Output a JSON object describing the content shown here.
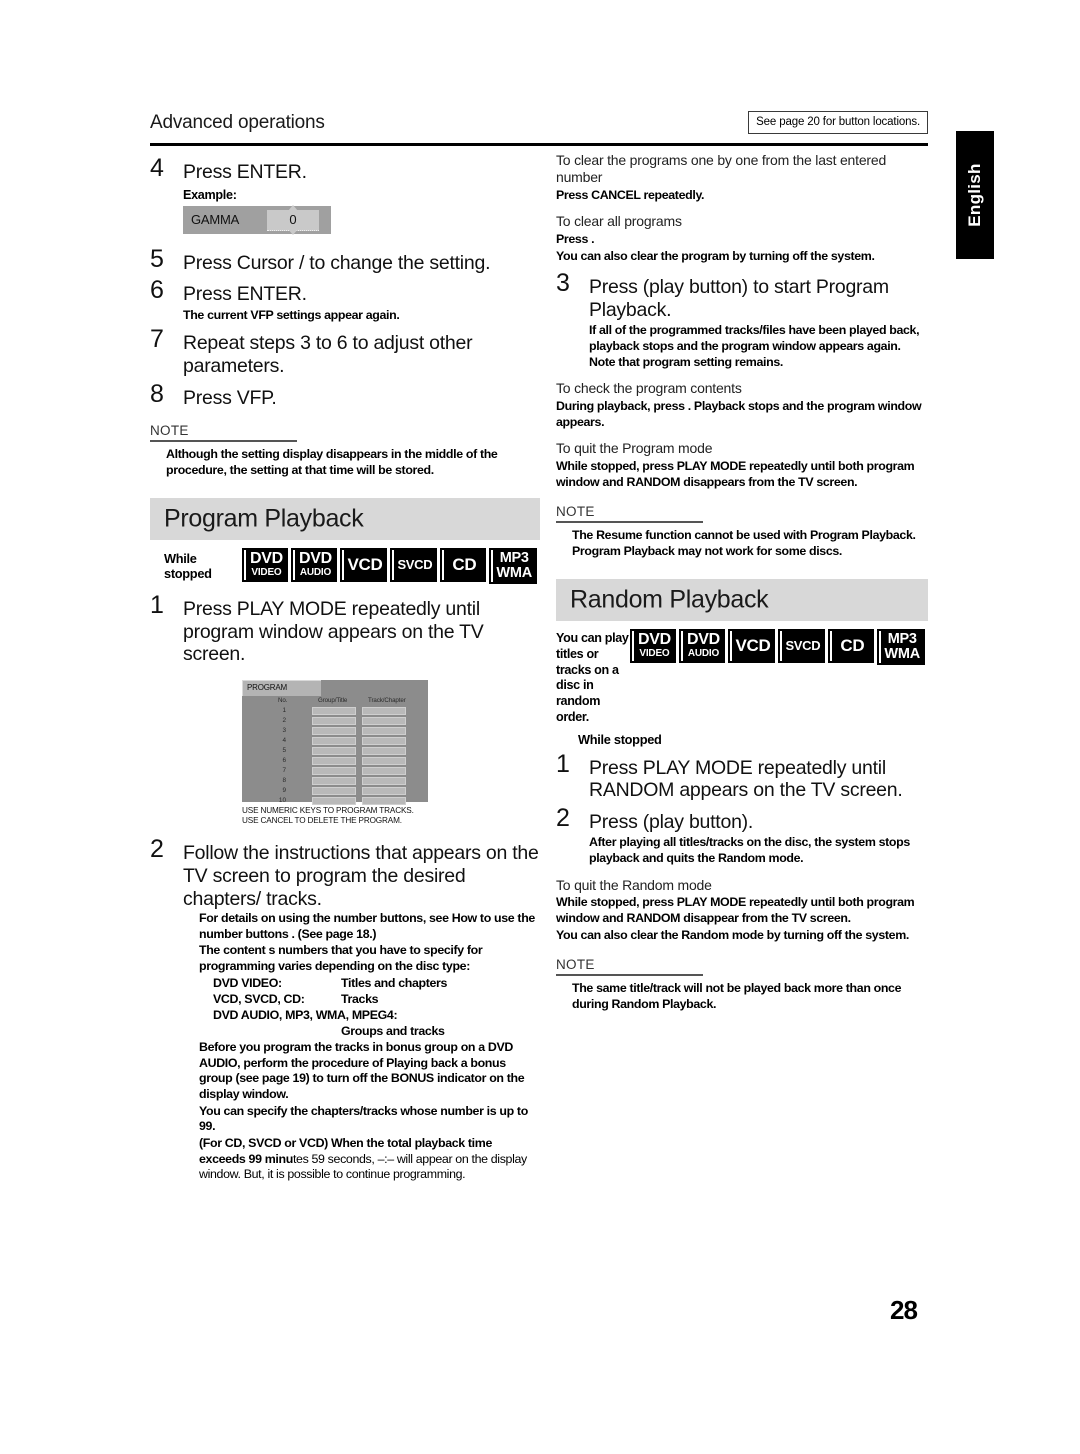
{
  "header": {
    "title": "Advanced operations",
    "reference_box": "See page 20 for button locations.",
    "language_tab": "English"
  },
  "page_number": "28",
  "left_column": {
    "step4": {
      "num": "4",
      "text": "Press ENTER.",
      "example_label": "Example:",
      "gamma": {
        "name": "GAMMA",
        "value": "0"
      }
    },
    "step5": {
      "num": "5",
      "text": "Press Cursor    /    to change the setting."
    },
    "step6": {
      "num": "6",
      "text": "Press ENTER.",
      "note": "The current VFP settings appear again."
    },
    "step7": {
      "num": "7",
      "text": "Repeat steps 3 to 6 to adjust other parameters."
    },
    "step8": {
      "num": "8",
      "text": "Press VFP."
    },
    "note1": {
      "label": "NOTE",
      "body": "Although the setting display disappears in the middle of the procedure, the setting at that time will be stored."
    },
    "section_heading": "Program Playback",
    "while_stopped": "While stopped",
    "badges": [
      {
        "line1": "DVD",
        "line2": "VIDEO"
      },
      {
        "line1": "DVD",
        "line2": "AUDIO"
      },
      {
        "line1": "VCD",
        "line2": ""
      },
      {
        "line1": "SVCD",
        "line2": ""
      },
      {
        "line1": "CD",
        "line2": ""
      },
      {
        "line1": "MP3",
        "line2": "WMA"
      }
    ],
    "step1": {
      "num": "1",
      "text": "Press PLAY MODE repeatedly until program window appears on the TV screen."
    },
    "program_window": {
      "title": "PROGRAM",
      "col_no": "No.",
      "col_group": "Group/Title",
      "col_track": "Track/Chapter",
      "rows": [
        "1",
        "2",
        "3",
        "4",
        "5",
        "6",
        "7",
        "8",
        "9",
        "10"
      ],
      "caption_line1": "USE NUMERIC KEYS TO PROGRAM TRACKS.",
      "caption_line2": "USE CANCEL TO DELETE THE PROGRAM."
    },
    "step2": {
      "num": "2",
      "text": "Follow the instructions that appears on the TV screen to program the desired chapters/ tracks.",
      "note1": "For details on using the number buttons, see   How to use the number buttons  . (See page 18.)",
      "note2": "The content s numbers that you have to specify for programming varies depending on the disc type:",
      "disc_types": [
        {
          "label": "DVD VIDEO:",
          "value": "Titles and chapters",
          "wrap": false
        },
        {
          "label": "VCD, SVCD, CD:",
          "value": "Tracks",
          "wrap": false
        },
        {
          "label": "DVD AUDIO, MP3, WMA, MPEG4:",
          "value": "Groups and tracks",
          "wrap": true
        }
      ],
      "note3": "Before you program the tracks in bonus group on a DVD AUDIO, perform the procedure of   Playing back a bonus group   (see page 19) to turn off the BONUS indicator on the display window.",
      "note4": "You can specify the chapters/tracks whose number is up to 99.",
      "note5_bold": "(For CD, SVCD or VCD) When the total playback time exceeds 99 minu",
      "note5_plain": "tes 59 seconds,   –:–   will appear on the display window. But, it is possible to continue programming."
    }
  },
  "right_column": {
    "clear_one_by_one": {
      "heading": "To clear the programs one by one from the last entered number",
      "body": "Press CANCEL repeatedly."
    },
    "clear_all": {
      "heading": "To clear all programs",
      "body1": "Press    .",
      "body2": "You can also clear the program by turning off the system."
    },
    "step3": {
      "num": "3",
      "text": "Press      (play button) to start Program Playback.",
      "note": "If all of the programmed tracks/files have been played back, playback stops and the program window appears again. Note that program setting remains."
    },
    "check_contents": {
      "heading": "To check the program contents",
      "body": "During playback, press    . Playback stops and the program window appears."
    },
    "quit_program": {
      "heading": "To quit the Program mode",
      "body": "While stopped, press PLAY MODE repeatedly until both program window and   RANDOM   disappears from the TV screen."
    },
    "note_program": {
      "label": "NOTE",
      "body": "The Resume function cannot be used with Program Playback. Program Playback may not work for some discs."
    },
    "section_heading": "Random Playback",
    "random_intro": "You can play titles or tracks on a disc in random order.",
    "while_stopped": "While stopped",
    "badges": [
      {
        "line1": "DVD",
        "line2": "VIDEO"
      },
      {
        "line1": "DVD",
        "line2": "AUDIO"
      },
      {
        "line1": "VCD",
        "line2": ""
      },
      {
        "line1": "SVCD",
        "line2": ""
      },
      {
        "line1": "CD",
        "line2": ""
      },
      {
        "line1": "MP3",
        "line2": "WMA"
      }
    ],
    "step1": {
      "num": "1",
      "text": "Press PLAY MODE repeatedly until   RANDOM   appears on the TV screen."
    },
    "step2": {
      "num": "2",
      "text": "Press      (play button).",
      "note": "After playing all titles/tracks on the disc, the system stops playback and quits the Random mode."
    },
    "quit_random": {
      "heading": "To quit the Random mode",
      "body1": "While stopped, press PLAY MODE repeatedly until both program window and   RANDOM   disappear from the TV screen.",
      "body2": "You can also clear the Random mode by turning off the system."
    },
    "note_random": {
      "label": "NOTE",
      "body": "The same title/track will not be played back more than once during Random Playback."
    }
  }
}
